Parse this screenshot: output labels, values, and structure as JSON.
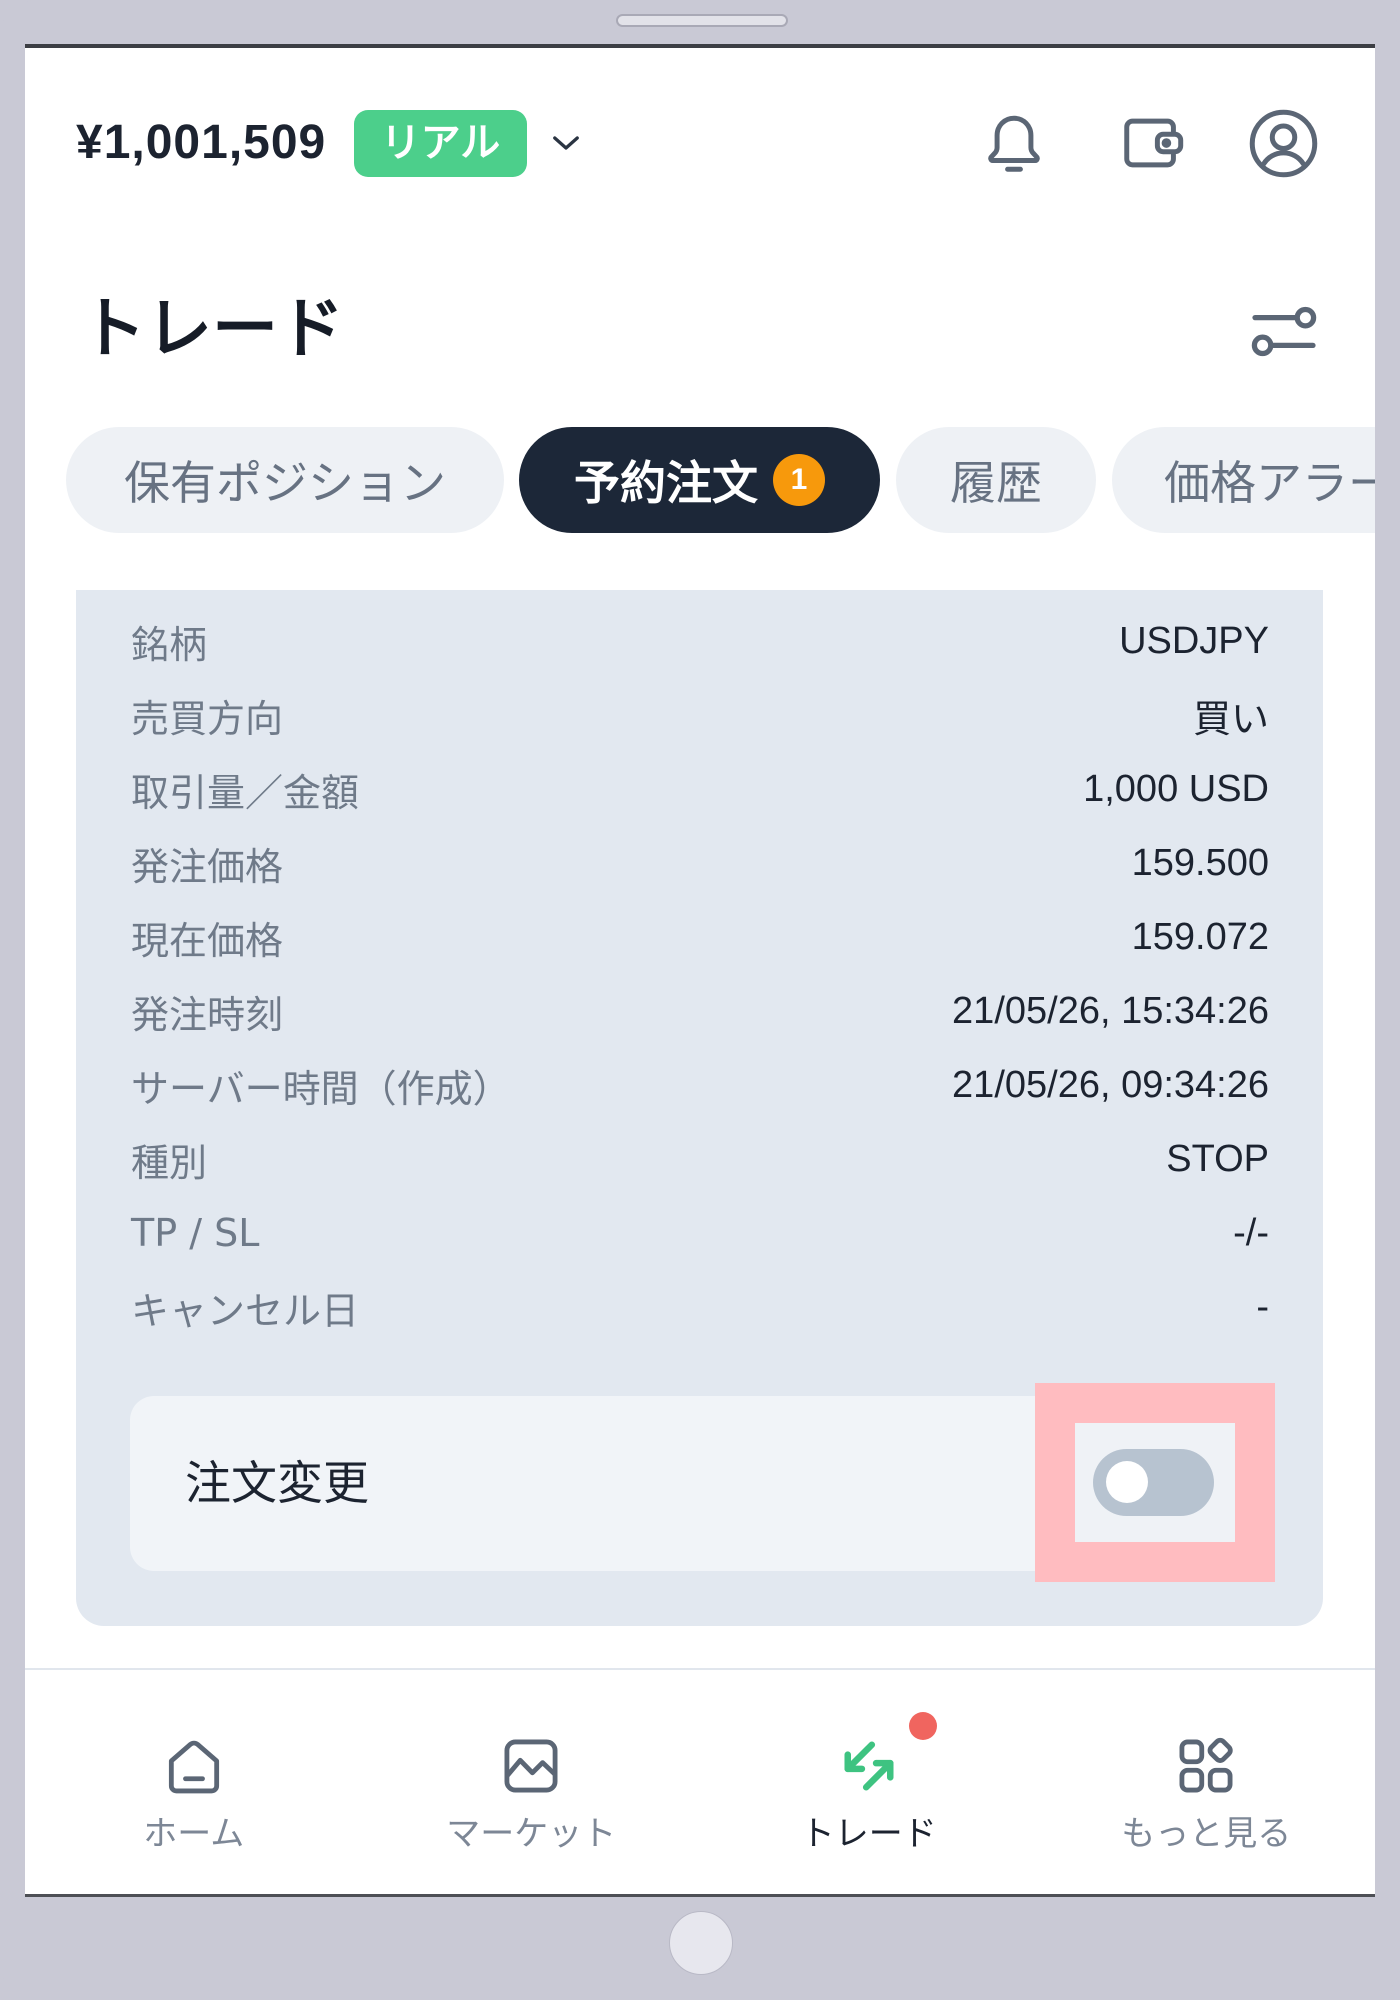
{
  "header": {
    "balance": "¥1,001,509",
    "account_badge": "リアル",
    "icons": {
      "dropdown": "chevron-down-icon",
      "notifications": "bell-icon",
      "wallet": "wallet-icon",
      "profile": "user-icon"
    }
  },
  "page": {
    "title": "トレード",
    "filter_icon": "sliders-icon"
  },
  "tabs": [
    {
      "label": "保有ポジション",
      "active": false
    },
    {
      "label": "予約注文",
      "active": true,
      "badge": "1"
    },
    {
      "label": "履歴",
      "active": false
    },
    {
      "label": "価格アラー",
      "active": false
    }
  ],
  "order": {
    "rows": [
      {
        "label": "銘柄",
        "value": "USDJPY"
      },
      {
        "label": "売買方向",
        "value": "買い"
      },
      {
        "label": "取引量／金額",
        "value": "1,000 USD"
      },
      {
        "label": "発注価格",
        "value": "159.500"
      },
      {
        "label": "現在価格",
        "value": "159.072"
      },
      {
        "label": "発注時刻",
        "value": "21/05/26, 15:34:26"
      },
      {
        "label": "サーバー時間（作成）",
        "value": "21/05/26, 09:34:26"
      },
      {
        "label": "種別",
        "value": "STOP"
      },
      {
        "label": "TP / SL",
        "value": "-/-"
      },
      {
        "label": "キャンセル日",
        "value": "-"
      }
    ],
    "modify": {
      "label": "注文変更",
      "toggle_on": false
    }
  },
  "bottom_nav": {
    "items": [
      {
        "label": "ホーム",
        "icon": "home-icon",
        "active": false
      },
      {
        "label": "マーケット",
        "icon": "chart-icon",
        "active": false
      },
      {
        "label": "トレード",
        "icon": "trade-arrows-icon",
        "active": true,
        "notification_dot": true
      },
      {
        "label": "もっと見る",
        "icon": "grid-icon",
        "active": false
      }
    ]
  },
  "colors": {
    "account_badge": "#4ccf8b",
    "trade_icon": "#3ec381",
    "active_tab": "#1c2738",
    "tab_badge": "#f7990c",
    "notification_dot": "#f0655f",
    "card_background": "#e2e8f0",
    "highlight": "#ffbcc0",
    "toggle_off": "#b7c3d0"
  }
}
